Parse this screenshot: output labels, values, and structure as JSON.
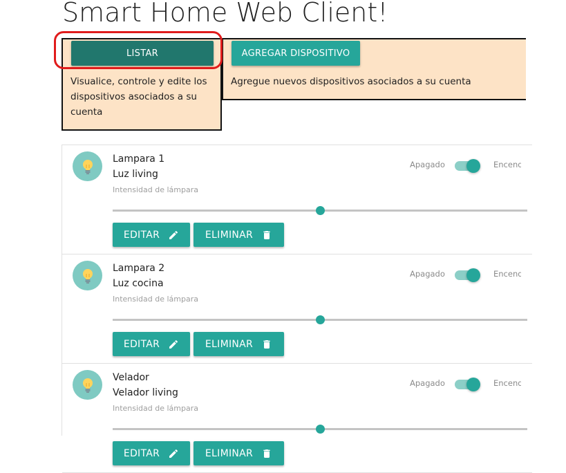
{
  "page": {
    "title": "Smart Home Web Client!"
  },
  "cards": {
    "list": {
      "button_label": "Listar",
      "description": "Visualice, controle y edite los dispositivos asociados a su cuenta"
    },
    "add": {
      "button_label": "Agregar dispositivo",
      "description": "Agregue nuevos dispositivos asociados a su cuenta"
    }
  },
  "colors": {
    "accent": "#26a69a",
    "accent_dark": "#21776d",
    "card_bg": "#fde3c6",
    "highlight": "#e01b1b"
  },
  "devices": [
    {
      "name": "Lampara 1",
      "room": "Luz living",
      "intensity_label": "Intensidad de lámpara",
      "switch_off": "Apagado",
      "switch_on": "Encendi",
      "on": true,
      "intensity": 50,
      "edit_label": "Editar",
      "delete_label": "Eliminar",
      "icon": "lightbulb-icon"
    },
    {
      "name": "Lampara 2",
      "room": "Luz cocina",
      "intensity_label": "Intensidad de lámpara",
      "switch_off": "Apagado",
      "switch_on": "Encendi",
      "on": true,
      "intensity": 50,
      "edit_label": "Editar",
      "delete_label": "Eliminar",
      "icon": "lightbulb-icon"
    },
    {
      "name": "Velador",
      "room": "Velador living",
      "intensity_label": "Intensidad de lámpara",
      "switch_off": "Apagado",
      "switch_on": "Encendi",
      "on": true,
      "intensity": 50,
      "edit_label": "Editar",
      "delete_label": "Eliminar",
      "icon": "lightbulb-icon"
    }
  ]
}
